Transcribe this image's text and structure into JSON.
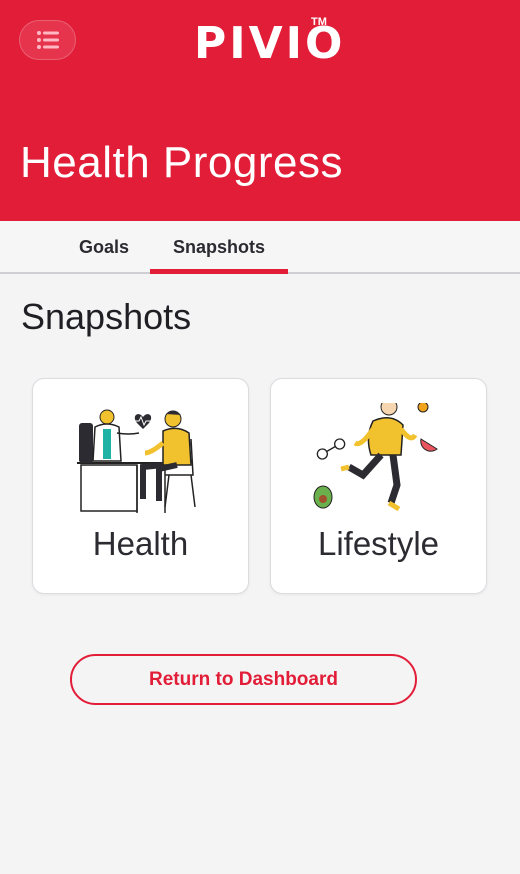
{
  "header": {
    "brand": "PIVIO",
    "brand_tm": "TM",
    "title": "Health Progress",
    "menu_icon": "menu-list-icon",
    "background": "#e21d38"
  },
  "tabs": [
    {
      "label": "Goals",
      "active": false
    },
    {
      "label": "Snapshots",
      "active": true
    }
  ],
  "main": {
    "section_title": "Snapshots",
    "cards": [
      {
        "label": "Health",
        "icon": "doctor-checkup-illustration"
      },
      {
        "label": "Lifestyle",
        "icon": "running-person-illustration"
      }
    ],
    "return_button": "Return to Dashboard"
  },
  "colors": {
    "accent": "#e21d38",
    "illustration_yellow": "#f2c12e",
    "illustration_teal": "#1fb3a5",
    "background": "#f4f4f5"
  }
}
